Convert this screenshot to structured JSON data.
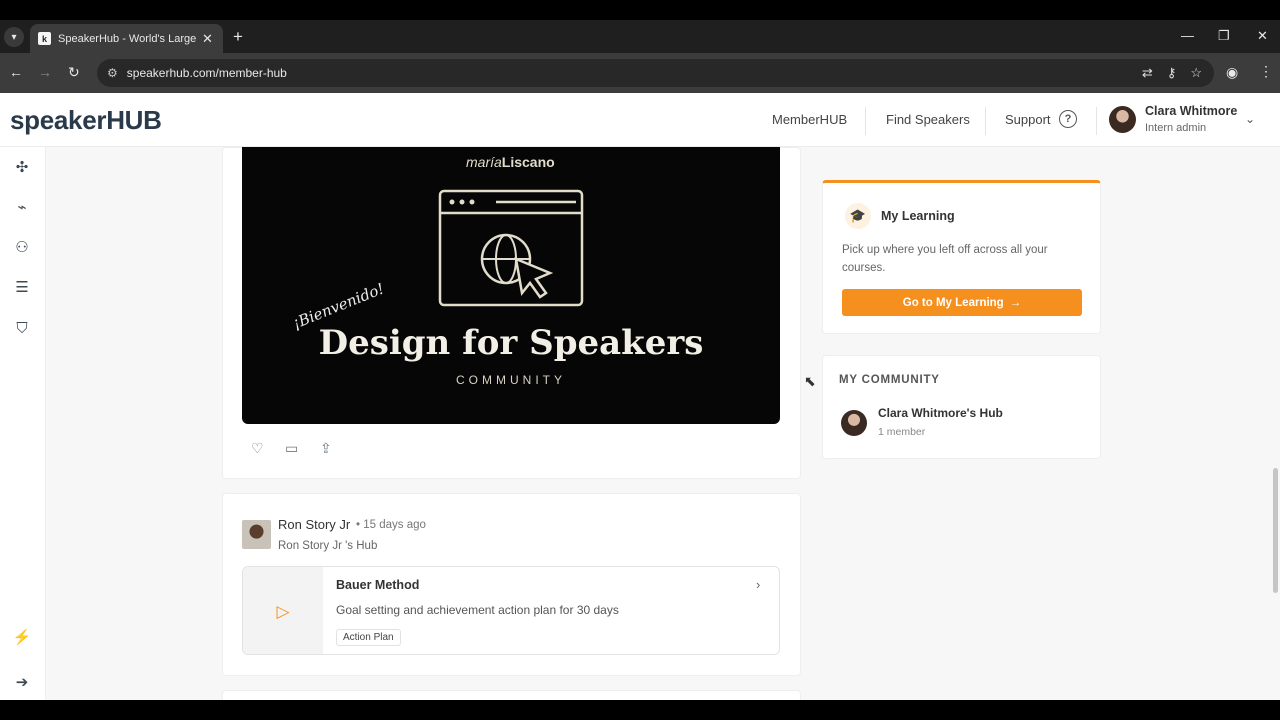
{
  "browser": {
    "tab_title": "SpeakerHub - World's Largest P",
    "url": "speakerhub.com/member-hub"
  },
  "header": {
    "logo_prefix": "speaker",
    "logo_suffix": "HUB",
    "nav": [
      "MemberHUB",
      "Find Speakers",
      "Support"
    ],
    "user": {
      "name": "Clara Whitmore",
      "role": "Intern admin"
    }
  },
  "post_image": {
    "brand_first": "maría",
    "brand_last": "Liscano",
    "welcome": "¡Bienvenido!",
    "title": "Design for Speakers",
    "subtitle": "COMMUNITY"
  },
  "post": {
    "author": "Ron Story Jr",
    "time": "• 15 days ago",
    "hub": "Ron Story Jr 's Hub",
    "course": {
      "title": "Bauer Method",
      "description": "Goal setting and achievement action plan for 30 days",
      "tag": "Action Plan"
    }
  },
  "learning": {
    "title": "My Learning",
    "description": "Pick up where you left off across all your courses.",
    "button": "Go to My Learning"
  },
  "community": {
    "heading": "MY COMMUNITY",
    "hub_name": "Clara Whitmore's Hub",
    "members": "1 member"
  },
  "colors": {
    "accent": "#f5901e",
    "text": "#333333"
  }
}
